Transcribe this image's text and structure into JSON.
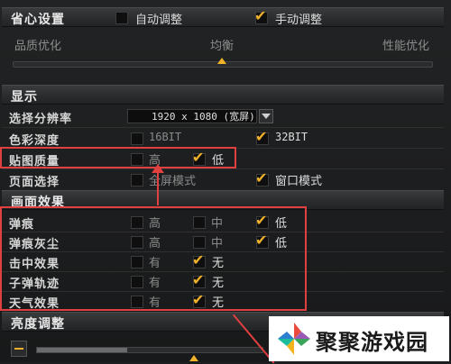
{
  "power": {
    "title": "省心设置",
    "auto_label": "自动调整",
    "manual_label": "手动调整",
    "auto_checked": false,
    "manual_checked": true,
    "slider_left": "品质优化",
    "slider_mid": "均衡",
    "slider_right": "性能优化",
    "slider_level": 0.5
  },
  "display": {
    "title": "显示",
    "resolution_label": "选择分辨率",
    "resolution_value": "1920 x 1080 (宽屏)",
    "color_label": "色彩深度",
    "color_16": "16BIT",
    "color_32": "32BIT",
    "texture_label": "贴图质量",
    "texture_high": "高",
    "texture_low": "低",
    "page_label": "页面选择",
    "fullscreen": "全屏模式",
    "windowed": "窗口模式"
  },
  "effects": {
    "title": "画面效果",
    "rows": [
      {
        "label": "弹痕",
        "opts": [
          "高",
          "中",
          "低"
        ]
      },
      {
        "label": "弹痕灰尘",
        "opts": [
          "高",
          "中",
          "低"
        ]
      },
      {
        "label": "击中效果",
        "opts": [
          "有",
          "无"
        ]
      },
      {
        "label": "子弹轨迹",
        "opts": [
          "有",
          "无"
        ]
      },
      {
        "label": "天气效果",
        "opts": [
          "有",
          "无"
        ]
      }
    ]
  },
  "brightness": {
    "title": "亮度调整",
    "level": 0.4
  },
  "watermark": {
    "text": "聚聚游戏园"
  },
  "colors": {
    "accent": "#f0b22a",
    "annotation": "#e04040"
  }
}
